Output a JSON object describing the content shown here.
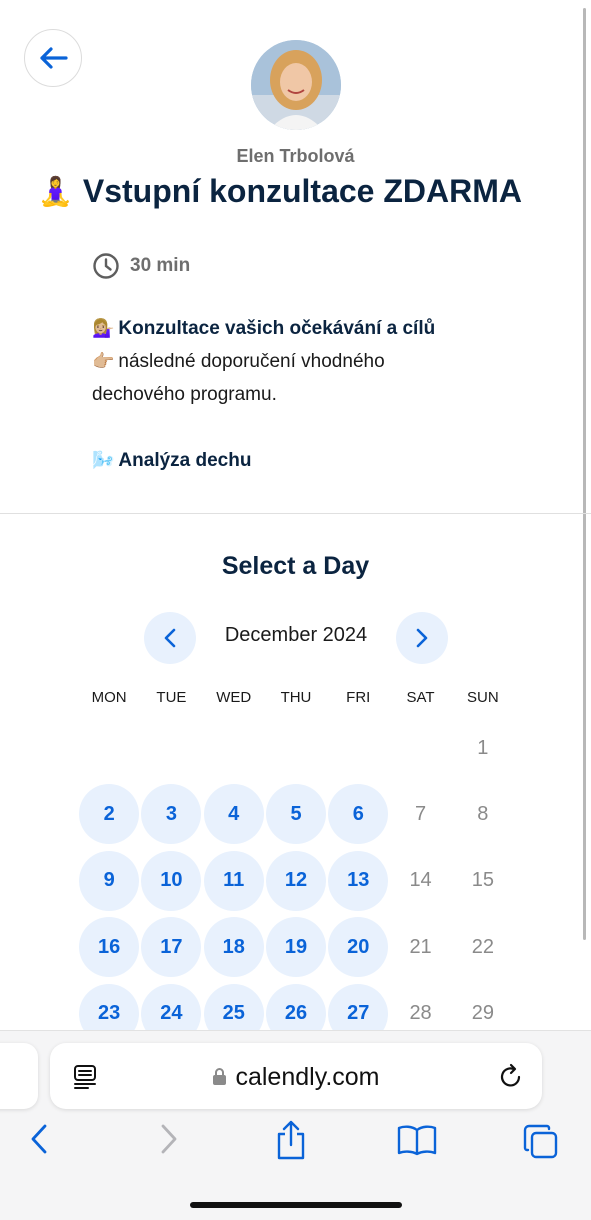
{
  "host": {
    "name": "Elen Trbolová"
  },
  "event": {
    "title_emoji": "🧘‍♀️",
    "title": "Vstupní konzultace ZDARMA",
    "duration": "30 min",
    "description": {
      "line1_emoji": "💁🏼‍♀️",
      "line1": "Konzultace vašich očekávání a cílů",
      "line2_emoji": "👉🏼",
      "line2": "následné doporučení vhodného",
      "line3": "dechového programu.",
      "line4_emoji": "🌬️",
      "line4": "Analýza dechu"
    }
  },
  "calendar": {
    "section_title": "Select a Day",
    "month_label": "December 2024",
    "weekdays": [
      "MON",
      "TUE",
      "WED",
      "THU",
      "FRI",
      "SAT",
      "SUN"
    ],
    "days": [
      {
        "label": "1",
        "available": false
      },
      {
        "label": "2",
        "available": true
      },
      {
        "label": "3",
        "available": true
      },
      {
        "label": "4",
        "available": true
      },
      {
        "label": "5",
        "available": true
      },
      {
        "label": "6",
        "available": true
      },
      {
        "label": "7",
        "available": false
      },
      {
        "label": "8",
        "available": false
      },
      {
        "label": "9",
        "available": true
      },
      {
        "label": "10",
        "available": true
      },
      {
        "label": "11",
        "available": true
      },
      {
        "label": "12",
        "available": true
      },
      {
        "label": "13",
        "available": true
      },
      {
        "label": "14",
        "available": false
      },
      {
        "label": "15",
        "available": false
      },
      {
        "label": "16",
        "available": true
      },
      {
        "label": "17",
        "available": true
      },
      {
        "label": "18",
        "available": true
      },
      {
        "label": "19",
        "available": true
      },
      {
        "label": "20",
        "available": true
      },
      {
        "label": "21",
        "available": false
      },
      {
        "label": "22",
        "available": false
      },
      {
        "label": "23",
        "available": true
      },
      {
        "label": "24",
        "available": true
      },
      {
        "label": "25",
        "available": true
      },
      {
        "label": "26",
        "available": true
      },
      {
        "label": "27",
        "available": true
      },
      {
        "label": "28",
        "available": false
      },
      {
        "label": "29",
        "available": false
      }
    ],
    "first_day_column": 6
  },
  "browser": {
    "url": "calendly.com"
  },
  "colors": {
    "accent": "#0a63d8",
    "available_bg": "#e8f1fd",
    "title_dark": "#0b2440"
  },
  "icons": {
    "back": "arrow-left-icon",
    "clock": "clock-icon",
    "prev_month": "chevron-left-icon",
    "next_month": "chevron-right-icon",
    "reader": "reader-icon",
    "lock": "lock-icon",
    "reload": "reload-icon",
    "back_nav": "chevron-left-icon",
    "forward_nav": "chevron-right-icon",
    "share": "share-icon",
    "bookmarks": "book-icon",
    "tabs": "tabs-icon"
  }
}
